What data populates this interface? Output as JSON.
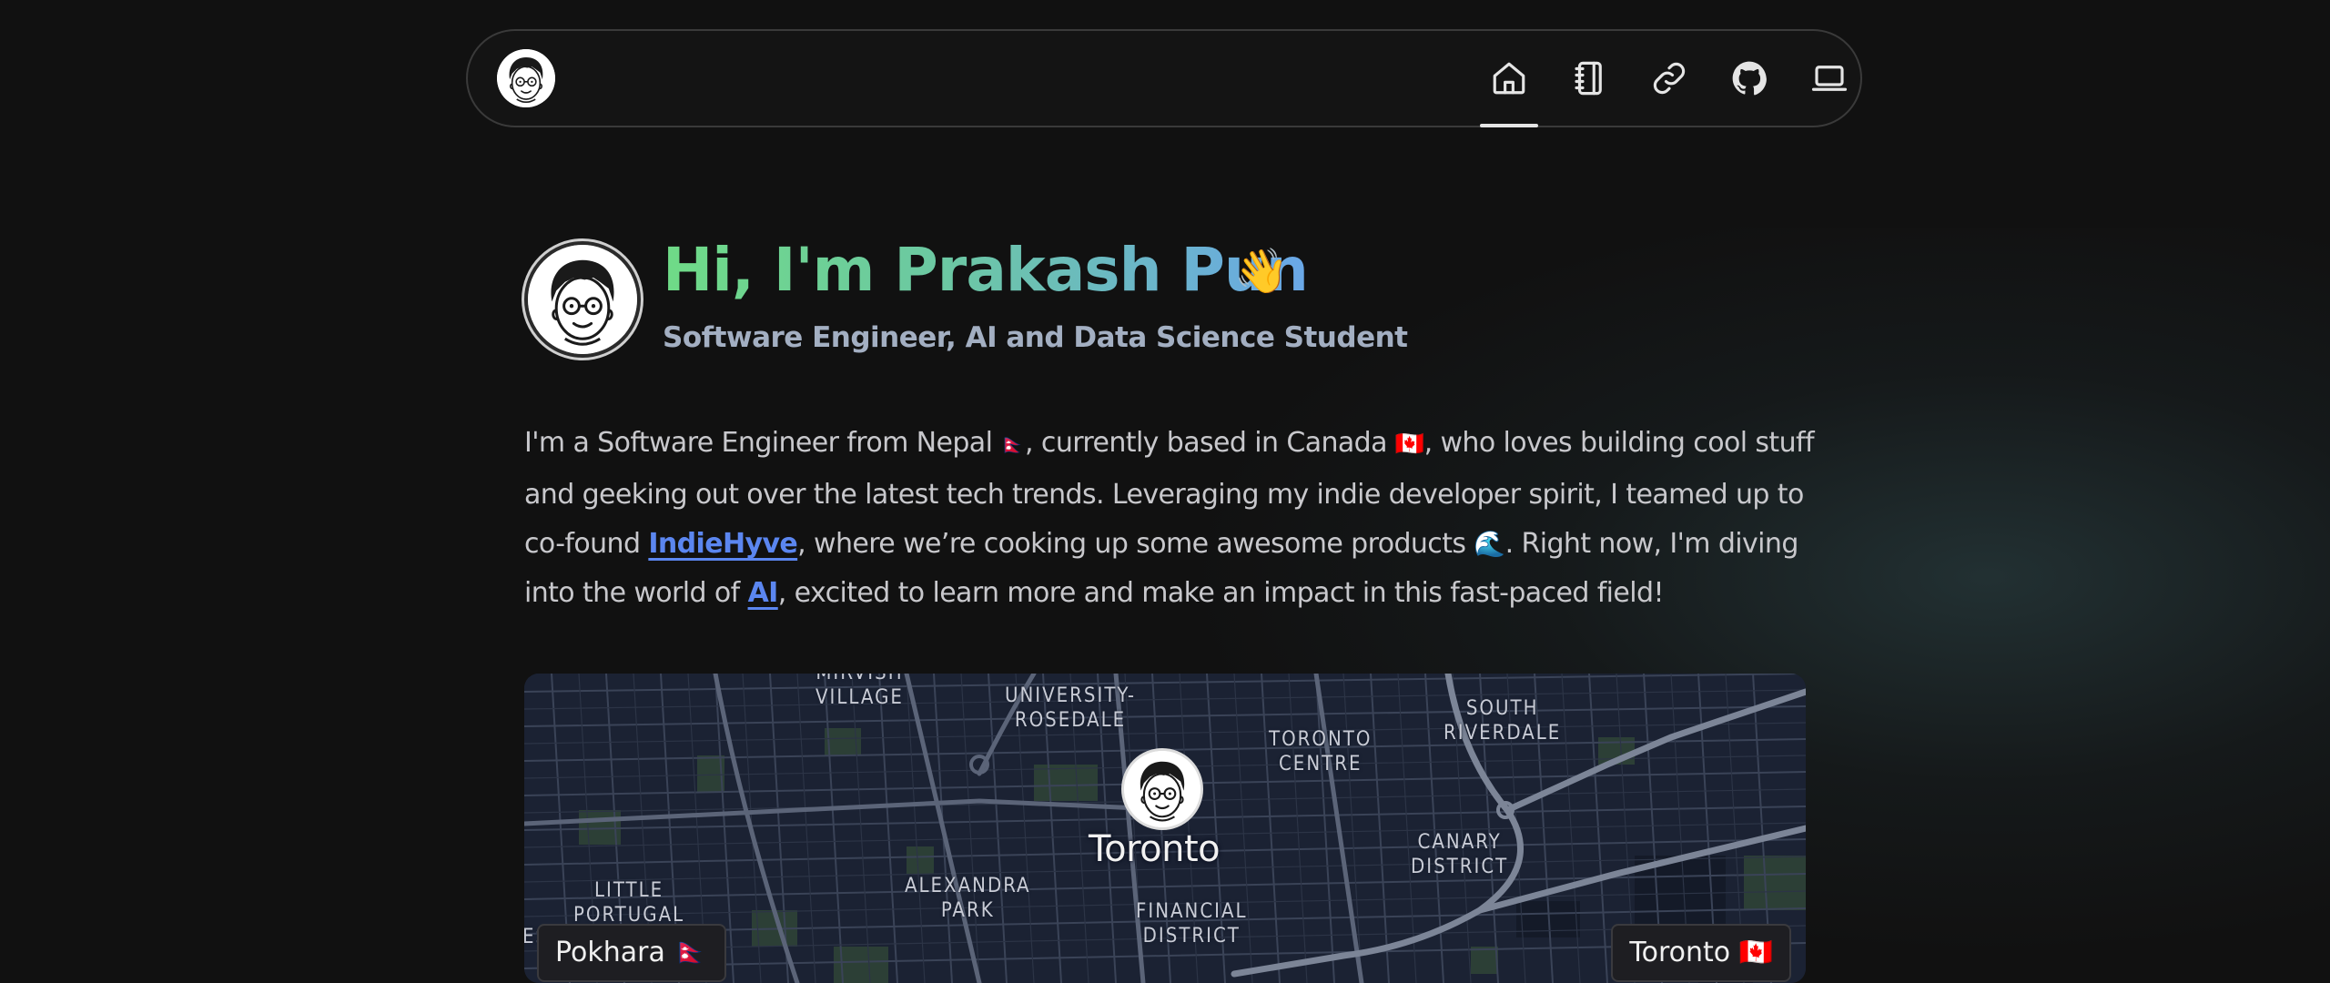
{
  "nav": {
    "items": [
      {
        "name": "home",
        "icon": "home-icon",
        "active": true
      },
      {
        "name": "notebook",
        "icon": "notebook-icon",
        "active": false
      },
      {
        "name": "links",
        "icon": "link-icon",
        "active": false
      },
      {
        "name": "github",
        "icon": "github-icon",
        "active": false
      },
      {
        "name": "laptop",
        "icon": "laptop-icon",
        "active": false
      }
    ]
  },
  "hero": {
    "title": "Hi, I'm Prakash Pun",
    "wave": "👋",
    "subtitle": "Software Engineer, AI and Data Science Student"
  },
  "bio": {
    "part1": "I'm a Software Engineer from Nepal ",
    "flag_np": "🇳🇵",
    "part2": ", currently based in Canada ",
    "flag_ca": "🇨🇦",
    "part3": ", who loves building cool stuff and geeking out over the latest tech trends. Leveraging my indie developer spirit, I teamed up to co-found ",
    "link_indiehyve": "IndieHyve",
    "part4": ", where we’re cooking up some awesome products ",
    "wave_emoji": "🌊",
    "part5": ". Right now, I'm diving into the world of ",
    "link_ai": "AI",
    "part6": ", excited to learn more and make an impact in this fast-paced field!"
  },
  "map": {
    "city": "Toronto",
    "neighborhoods": {
      "mirvish": "MIRVISH\nVILLAGE",
      "university": "UNIVERSITY-\nROSEDALE",
      "toronto_centre": "TORONTO\nCENTRE",
      "south_riverdale": "SOUTH\nRIVERDALE",
      "canary": "CANARY\nDISTRICT",
      "little_portugal": "LITTLE\nPORTUGAL",
      "alexandra": "ALEXANDRA\nPARK",
      "financial": "FINANCIAL\nDISTRICT",
      "edge": "ES"
    },
    "tag_left": "Pokhara 🇳🇵",
    "tag_right": "Toronto 🇨🇦"
  },
  "colors": {
    "background": "#111111",
    "accent_link": "#5b86f0",
    "title_gradient_start": "#6fdb87",
    "title_gradient_end": "#6aa7e8",
    "map_base": "#1b2233"
  }
}
